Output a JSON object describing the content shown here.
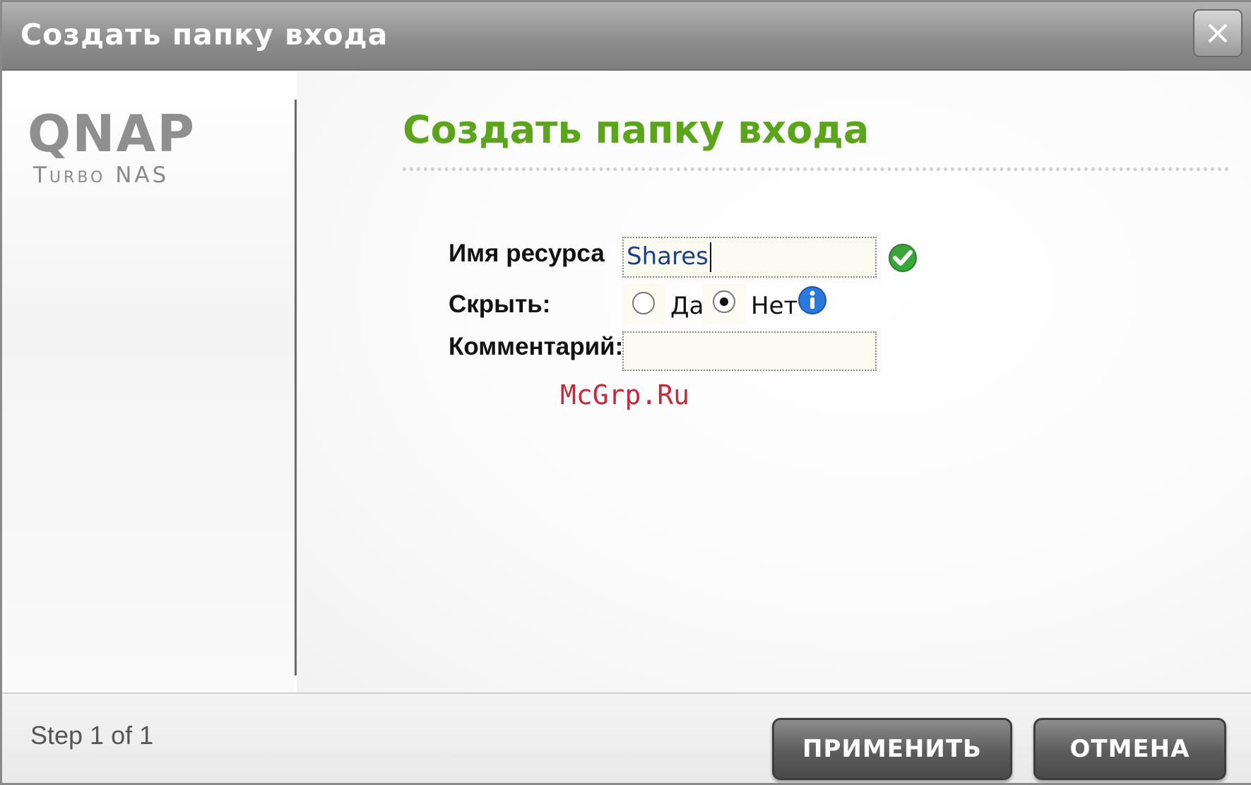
{
  "window": {
    "title": "Создать папку входа",
    "close_label": "X"
  },
  "sidebar": {
    "logo_text": "QNAP",
    "logo_subtitle": "Turbo NAS"
  },
  "main": {
    "heading": "Создать папку входа",
    "form": {
      "resource_label": "Имя ресурса",
      "resource_value": "Shares",
      "hide_label": "Скрыть:",
      "hide_options": [
        "Да",
        "Нет"
      ],
      "hide_selected": "Нет",
      "comment_label": "Комментарий:",
      "comment_value": ""
    },
    "watermark": "McGrp.Ru"
  },
  "footer": {
    "step_text": "Step 1 of 1",
    "apply_label": "ПРИМЕНИТЬ",
    "cancel_label": "ОТМЕНА"
  },
  "colors": {
    "heading_green": "#5aa51a",
    "valid_green": "#3aa53a",
    "info_blue": "#2a78e0"
  }
}
